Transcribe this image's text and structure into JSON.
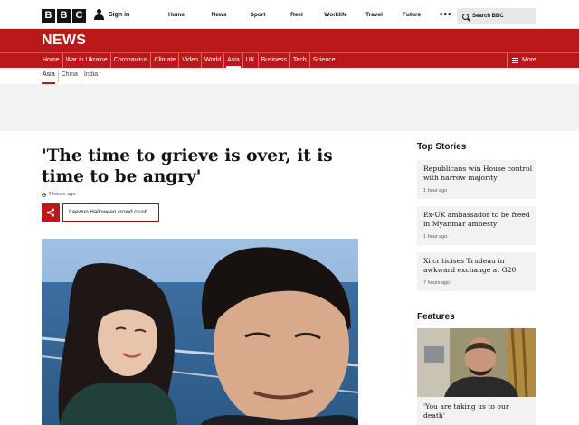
{
  "brand": {
    "logo_letters": [
      "B",
      "B",
      "C"
    ]
  },
  "header": {
    "signin_label": "Sign in",
    "nav": [
      "Home",
      "News",
      "Sport",
      "Reel",
      "Worklife",
      "Travel",
      "Future"
    ],
    "more_dots": "•••",
    "search_placeholder": "Search BBC"
  },
  "section": {
    "title": "NEWS"
  },
  "news_nav": {
    "items": [
      "Home",
      "War in Ukraine",
      "Coronavirus",
      "Climate",
      "Video",
      "World",
      "Asia",
      "UK",
      "Business",
      "Tech",
      "Science"
    ],
    "active": "Asia",
    "more_label": "More"
  },
  "sub_nav": {
    "items": [
      "Asia",
      "China",
      "India"
    ],
    "active": "Asia"
  },
  "article": {
    "headline": "'The time to grieve is over, it is time to be angry'",
    "timestamp": "4 hours ago",
    "topic_tag": "Itaewon Halloween crowd crush"
  },
  "sidebar": {
    "top_stories_title": "Top Stories",
    "stories": [
      {
        "headline": "Republicans win House control with narrow majority",
        "time": "1 hour ago"
      },
      {
        "headline": "Ex-UK ambassador to be freed in Myanmar amnesty",
        "time": "1 hour ago"
      },
      {
        "headline": "Xi criticises Trudeau in awkward exchange at G20",
        "time": "7 hours ago"
      }
    ],
    "features_title": "Features",
    "feature": {
      "headline": "'You are taking us to our death'"
    }
  },
  "colors": {
    "brand_red": "#bb1919",
    "panel_grey": "#f2f2f2"
  }
}
